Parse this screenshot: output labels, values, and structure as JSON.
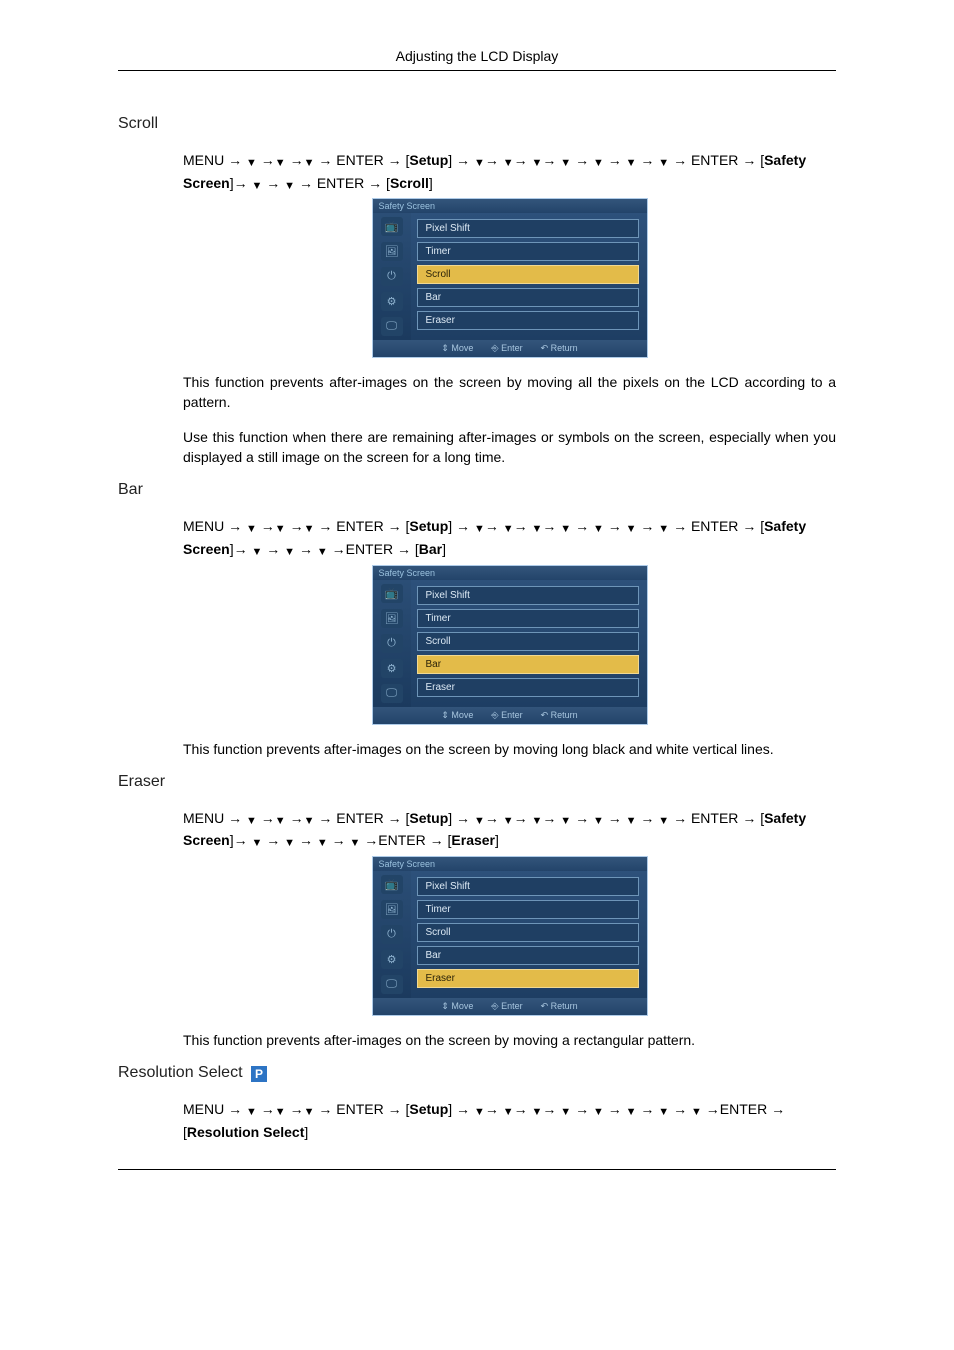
{
  "header": {
    "title": "Adjusting the LCD Display"
  },
  "glyph": {
    "down": "▼",
    "arrow": "→"
  },
  "nav": {
    "menu": "MENU",
    "enter": "ENTER",
    "setup": "Setup",
    "safety": "Safety Screen",
    "scroll": "Scroll",
    "bar": "Bar",
    "eraser": "Eraser",
    "resolution": "Resolution Select"
  },
  "sections": {
    "scroll": {
      "heading": "Scroll",
      "para1": "This function prevents after-images on the screen by moving all the pixels on the LCD according to a pattern.",
      "para2": "Use this function when there are remaining after-images or symbols on the screen, especially when you displayed a still image on the screen for a long time."
    },
    "bar": {
      "heading": "Bar",
      "para1": "This function prevents after-images on the screen by moving long black and white vertical lines."
    },
    "eraser": {
      "heading": "Eraser",
      "para1": "This function prevents after-images on the screen by moving a rectangular pattern."
    },
    "resolution": {
      "heading": "Resolution Select",
      "badge": "P"
    }
  },
  "osd": {
    "title": "Safety Screen",
    "items": [
      "Pixel Shift",
      "Timer",
      "Scroll",
      "Bar",
      "Eraser"
    ],
    "footer": {
      "move": "Move",
      "enter": "Enter",
      "return": "Return"
    },
    "icons": [
      "📺",
      "🖼",
      "⏻",
      "⚙",
      "🖵"
    ]
  }
}
